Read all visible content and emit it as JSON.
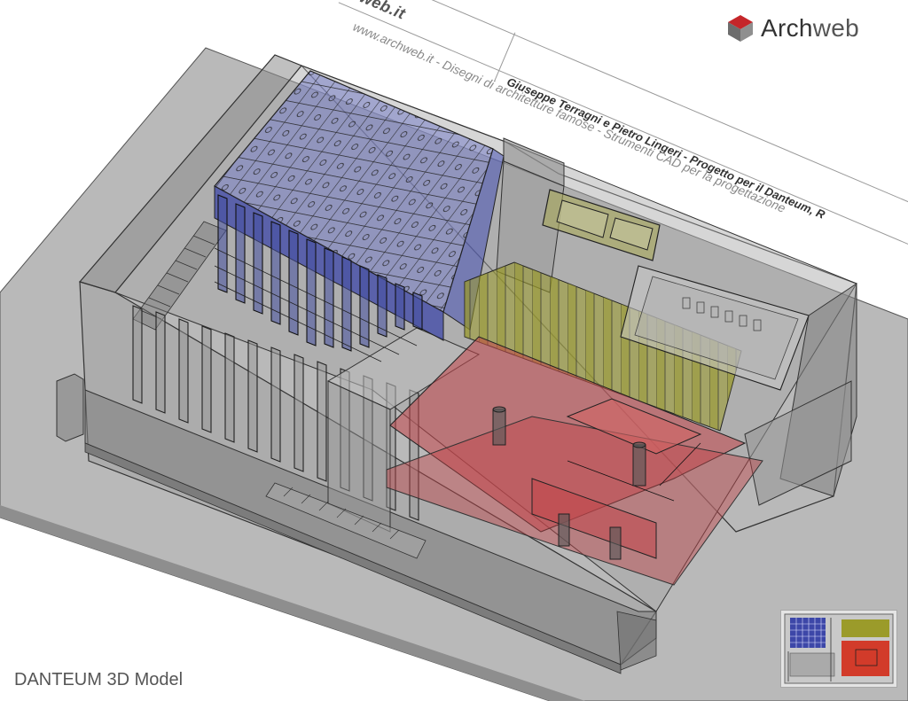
{
  "header": {
    "site_short": "www.archweb.it",
    "site_partial": "web.it",
    "line_project": "Giuseppe Terragni e Pietro Lingeri -  Progetto per il Danteum, R",
    "line_site": "www.archweb.it -   Disegni di architetture famose - Strumenti CAD  per la progettazione"
  },
  "logo": {
    "brand_dark": "Arch",
    "brand_light": "web",
    "icon": "cube-logo-icon",
    "accent": "#c5262a"
  },
  "caption": "DANTEUM 3D Model",
  "colors": {
    "blue_volume": "#3d47a8",
    "yellow_volume": "#9b9b2a",
    "red_volume": "#c2454a",
    "gray_base": "#9a9a9a"
  }
}
